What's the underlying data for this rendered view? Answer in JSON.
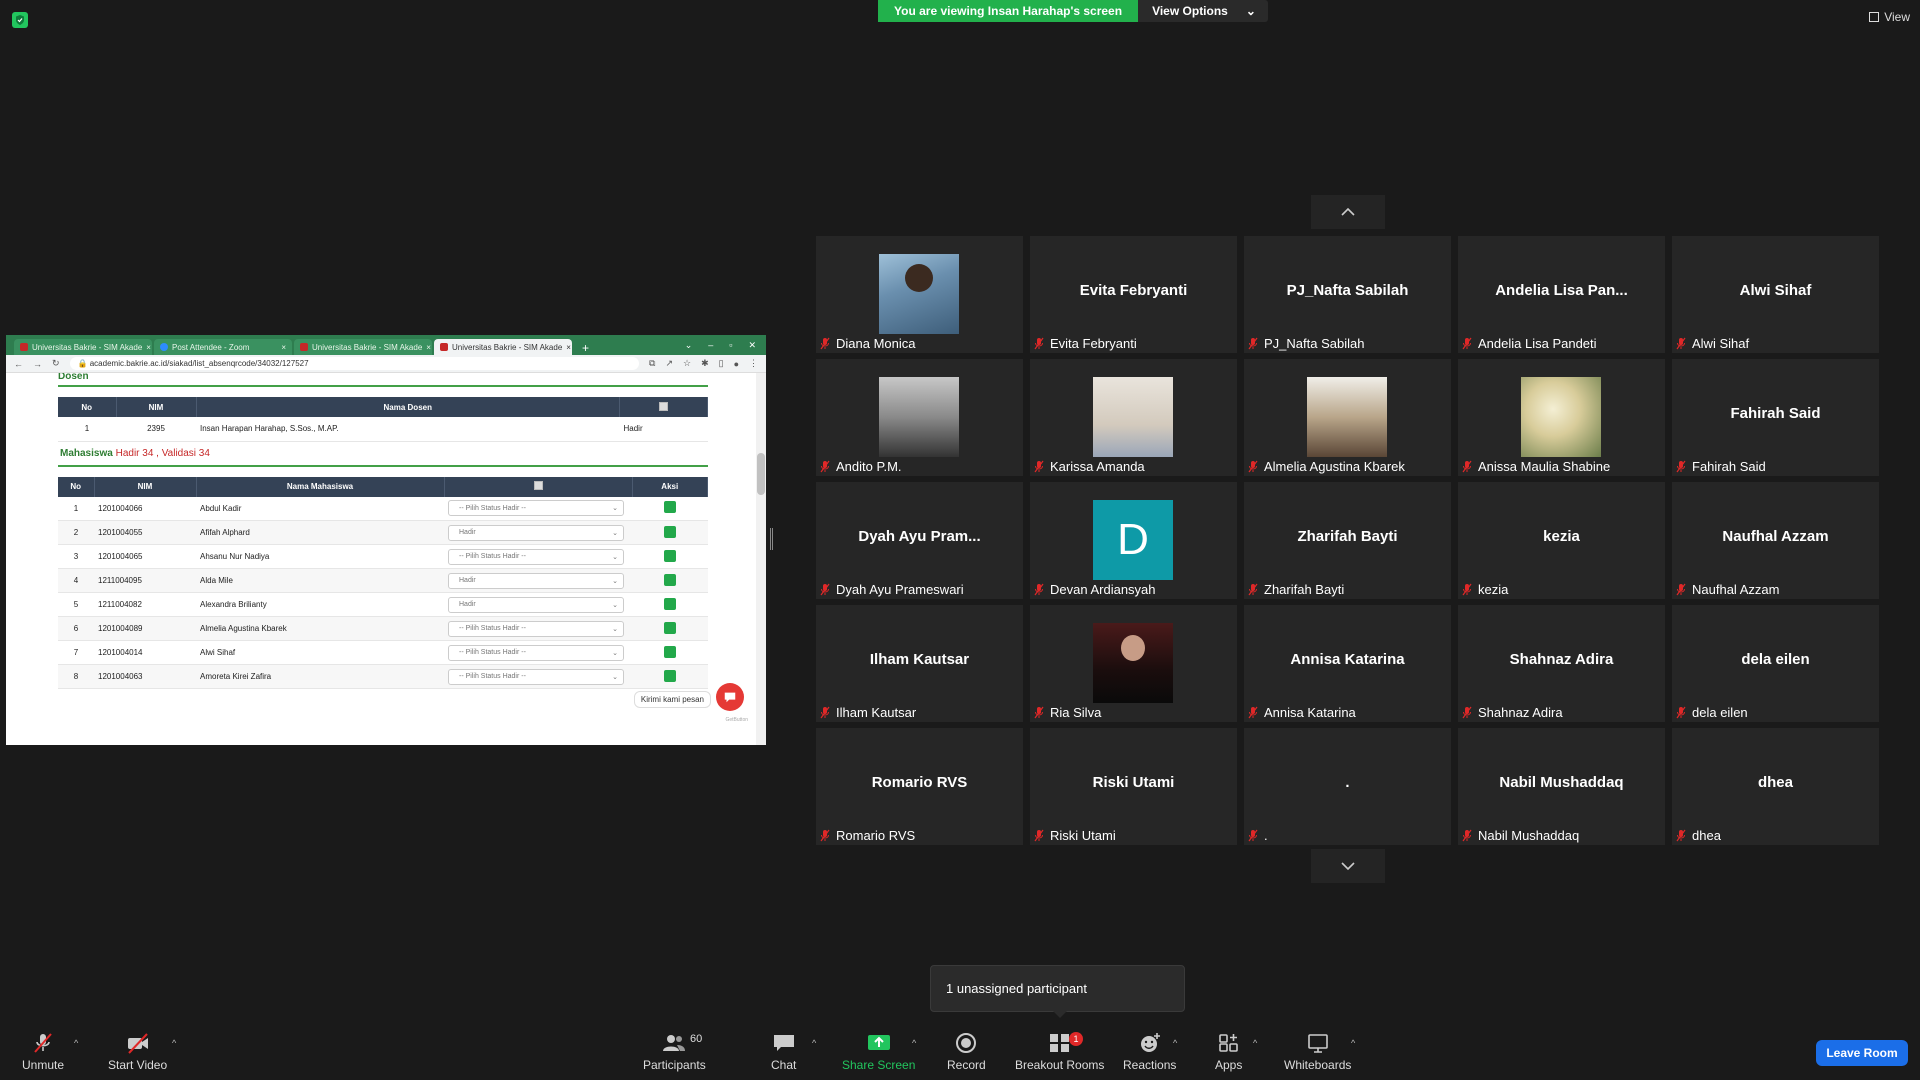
{
  "top": {
    "viewing_text": "You are viewing Insan Harahap's screen",
    "view_options": "View Options",
    "view": "View"
  },
  "browser": {
    "tabs": [
      {
        "title": "Universitas Bakrie - SIM Akade"
      },
      {
        "title": "Post Attendee - Zoom"
      },
      {
        "title": "Universitas Bakrie - SIM Akade"
      },
      {
        "title": "Universitas Bakrie - SIM Akade"
      }
    ],
    "url": "academic.bakrie.ac.id/siakad/list_absenqrcode/34032/127527"
  },
  "page": {
    "dosen_title": "Dosen",
    "dosen_headers": {
      "no": "No",
      "nim": "NIM",
      "nama": "Nama Dosen"
    },
    "dosen_row": {
      "no": "1",
      "nim": "2395",
      "nama": "Insan Harapan Harahap, S.Sos., M.AP.",
      "status": "Hadir"
    },
    "mhs_label": "Mahasiswa",
    "mhs_hadir": "Hadir 34",
    "mhs_sep": " , ",
    "mhs_validasi": "Validasi 34",
    "mhs_headers": {
      "no": "No",
      "nim": "NIM",
      "nama": "Nama Mahasiswa",
      "aksi": "Aksi"
    },
    "rows": [
      {
        "no": "1",
        "nim": "1201004066",
        "nama": "Abdul Kadir",
        "status": "-- Pilih Status Hadir --"
      },
      {
        "no": "2",
        "nim": "1201004055",
        "nama": "Afifah Alphard",
        "status": "Hadir"
      },
      {
        "no": "3",
        "nim": "1201004065",
        "nama": "Ahsanu Nur Nadiya",
        "status": "-- Pilih Status Hadir --"
      },
      {
        "no": "4",
        "nim": "1211004095",
        "nama": "Alda Mile",
        "status": "Hadir"
      },
      {
        "no": "5",
        "nim": "1211004082",
        "nama": "Alexandra Brilianty",
        "status": "Hadir"
      },
      {
        "no": "6",
        "nim": "1201004089",
        "nama": "Almelia Agustina Kbarek",
        "status": "-- Pilih Status Hadir --"
      },
      {
        "no": "7",
        "nim": "1201004014",
        "nama": "Alwi Sihaf",
        "status": "-- Pilih Status Hadir --"
      },
      {
        "no": "8",
        "nim": "1201004063",
        "nama": "Amoreta Kirei Zafira",
        "status": "-- Pilih Status Hadir --"
      }
    ],
    "chat_tip": "Kirimi kami pesan",
    "getbutton": "GetButton"
  },
  "participants": [
    {
      "name": "Diana Monica",
      "label": "Diana Monica",
      "photo": "diana"
    },
    {
      "name": "Evita Febryanti",
      "label": "Evita Febryanti"
    },
    {
      "name": "PJ_Nafta Sabilah",
      "label": "PJ_Nafta Sabilah"
    },
    {
      "name": "Andelia Lisa Pan...",
      "label": "Andelia Lisa Pandeti"
    },
    {
      "name": "Alwi Sihaf",
      "label": "Alwi Sihaf"
    },
    {
      "name": "Andito P.M.",
      "label": "Andito P.M.",
      "photo": "andito"
    },
    {
      "name": "Karissa Amanda",
      "label": "Karissa Amanda",
      "photo": "karissa"
    },
    {
      "name": "Almelia Agustina Kbarek",
      "label": "Almelia Agustina Kbarek",
      "photo": "almelia"
    },
    {
      "name": "Anissa Maulia Shabine",
      "label": "Anissa Maulia Shabine",
      "photo": "anissa"
    },
    {
      "name": "Fahirah Said",
      "label": "Fahirah Said"
    },
    {
      "name": "Dyah Ayu Pram...",
      "label": "Dyah Ayu Prameswari"
    },
    {
      "name": "Devan Ardiansyah",
      "label": "Devan Ardiansyah",
      "avatar": "D"
    },
    {
      "name": "Zharifah Bayti",
      "label": "Zharifah Bayti"
    },
    {
      "name": "kezia",
      "label": "kezia"
    },
    {
      "name": "Naufhal Azzam",
      "label": "Naufhal Azzam"
    },
    {
      "name": "Ilham Kautsar",
      "label": "Ilham Kautsar"
    },
    {
      "name": "Ria Silva",
      "label": "Ria Silva",
      "photo": "ria"
    },
    {
      "name": "Annisa Katarina",
      "label": "Annisa Katarina"
    },
    {
      "name": "Shahnaz Adira",
      "label": "Shahnaz Adira"
    },
    {
      "name": "dela eilen",
      "label": "dela eilen"
    },
    {
      "name": "Romario RVS",
      "label": "Romario RVS"
    },
    {
      "name": "Riski Utami",
      "label": "Riski Utami"
    },
    {
      "name": ".",
      "label": "."
    },
    {
      "name": "Nabil Mushaddaq",
      "label": "Nabil Mushaddaq"
    },
    {
      "name": "dhea",
      "label": "dhea"
    }
  ],
  "toast": "1 unassigned participant",
  "toolbar": {
    "unmute": "Unmute",
    "start_video": "Start Video",
    "participants": "Participants",
    "participants_count": "60",
    "chat": "Chat",
    "share_screen": "Share Screen",
    "record": "Record",
    "breakout": "Breakout Rooms",
    "breakout_badge": "1",
    "reactions": "Reactions",
    "apps": "Apps",
    "whiteboards": "Whiteboards",
    "leave": "Leave Room"
  },
  "colors": {
    "share_green": "#22c55e",
    "leave_blue": "#1b6ee8",
    "banner_green": "#22b14c"
  }
}
